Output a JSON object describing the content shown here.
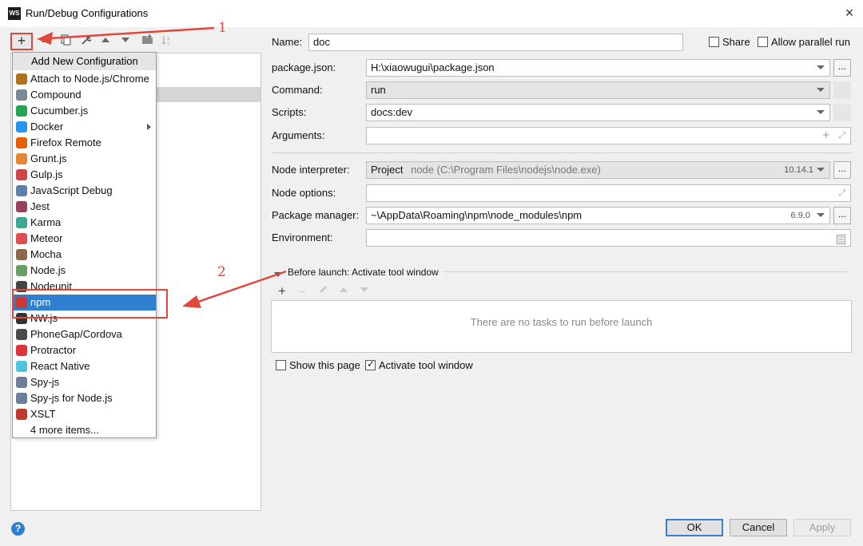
{
  "window": {
    "title": "Run/Debug Configurations",
    "app_icon": "WS",
    "close_glyph": "×"
  },
  "toolbar": {
    "add": "+",
    "remove": "–"
  },
  "add_menu": {
    "header": "Add New Configuration",
    "items": [
      {
        "label": "Attach to Node.js/Chrome",
        "icon": "js",
        "color": "#b07219"
      },
      {
        "label": "Compound",
        "icon": "compound",
        "color": "#7a8a99"
      },
      {
        "label": "Cucumber.js",
        "icon": "cucumber",
        "color": "#23a455"
      },
      {
        "label": "Docker",
        "icon": "docker",
        "color": "#2496ed",
        "submenu": true
      },
      {
        "label": "Firefox Remote",
        "icon": "firefox",
        "color": "#e66000"
      },
      {
        "label": "Grunt.js",
        "icon": "grunt",
        "color": "#e48632"
      },
      {
        "label": "Gulp.js",
        "icon": "gulp",
        "color": "#cf4647"
      },
      {
        "label": "JavaScript Debug",
        "icon": "js-debug",
        "color": "#5b7fa8"
      },
      {
        "label": "Jest",
        "icon": "jest",
        "color": "#99425b"
      },
      {
        "label": "Karma",
        "icon": "karma",
        "color": "#3aa893"
      },
      {
        "label": "Meteor",
        "icon": "meteor",
        "color": "#de4f4f"
      },
      {
        "label": "Mocha",
        "icon": "mocha",
        "color": "#8d6748"
      },
      {
        "label": "Node.js",
        "icon": "nodejs",
        "color": "#689f63"
      },
      {
        "label": "Nodeunit",
        "icon": "nodeunit",
        "color": "#444444"
      },
      {
        "label": "npm",
        "icon": "npm",
        "color": "#cb3837",
        "selected": true
      },
      {
        "label": "NW.js",
        "icon": "nwjs",
        "color": "#333333"
      },
      {
        "label": "PhoneGap/Cordova",
        "icon": "phonegap",
        "color": "#4a4a4a"
      },
      {
        "label": "Protractor",
        "icon": "protractor",
        "color": "#e23237"
      },
      {
        "label": "React Native",
        "icon": "react",
        "color": "#4fc3e0"
      },
      {
        "label": "Spy-js",
        "icon": "spy-js",
        "color": "#6b7f99"
      },
      {
        "label": "Spy-js for Node.js",
        "icon": "spy-js-node",
        "color": "#6b7f99"
      },
      {
        "label": "XSLT",
        "icon": "xslt",
        "color": "#c0392b"
      },
      {
        "label": "4 more items...",
        "icon": "",
        "color": ""
      }
    ]
  },
  "form": {
    "name_label": "Name:",
    "name_value": "doc",
    "share_label": "Share",
    "parallel_label": "Allow parallel run",
    "package_json_label": "package.json:",
    "package_json_value": "H:\\xiaowugui\\package.json",
    "command_label": "Command:",
    "command_value": "run",
    "scripts_label": "Scripts:",
    "scripts_value": "docs:dev",
    "arguments_label": "Arguments:",
    "node_interpreter_label": "Node interpreter:",
    "node_interpreter_project": "Project",
    "node_interpreter_path": "node (C:\\Program Files\\nodejs\\node.exe)",
    "node_interpreter_version": "10.14.1",
    "node_options_label": "Node options:",
    "package_manager_label": "Package manager:",
    "package_manager_value": "~\\AppData\\Roaming\\npm\\node_modules\\npm",
    "package_manager_version": "6.9.0",
    "environment_label": "Environment:",
    "dots": "..."
  },
  "before_launch": {
    "title": "Before launch: Activate tool window",
    "empty_text": "There are no tasks to run before launch",
    "show_page_label": "Show this page",
    "activate_label": "Activate tool window"
  },
  "buttons": {
    "ok": "OK",
    "cancel": "Cancel",
    "apply": "Apply",
    "help": "?"
  },
  "annotations": {
    "step1": "1",
    "step2": "2",
    "color": "#e0483c"
  }
}
